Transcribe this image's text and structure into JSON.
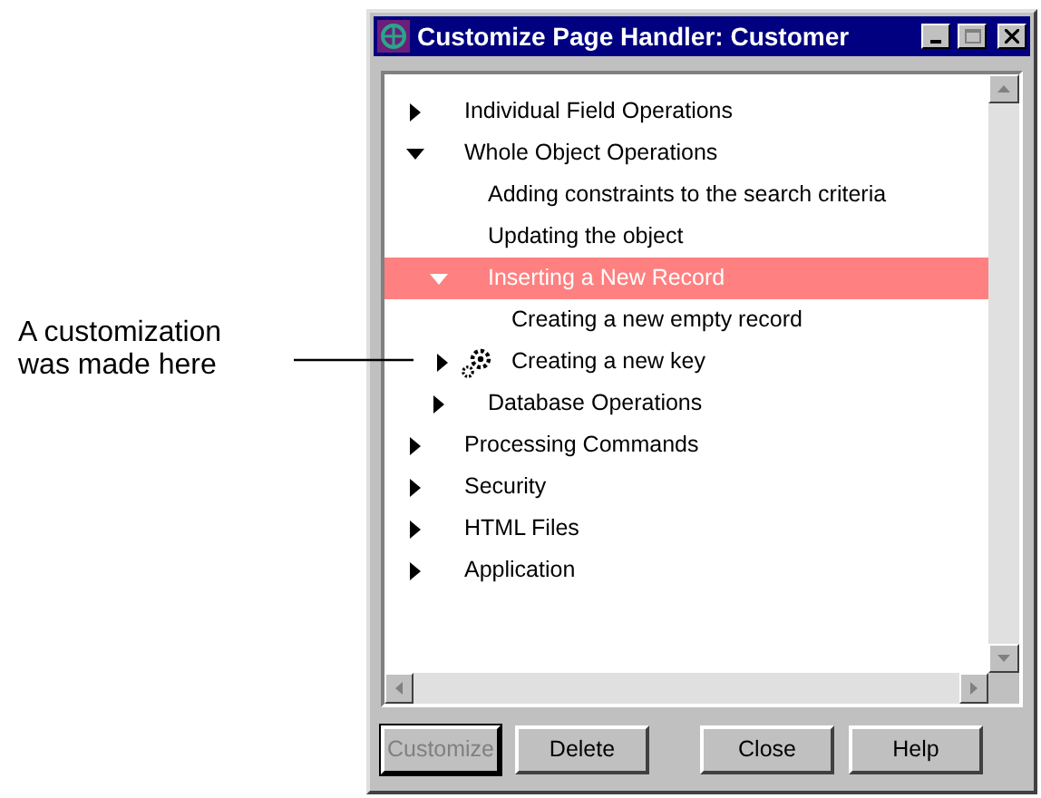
{
  "annotation": {
    "text": "A customization was made here"
  },
  "window": {
    "title": "Customize Page Handler: Customer"
  },
  "tree": [
    {
      "label": "Individual Field Operations",
      "expanded": false,
      "selected": false,
      "customized": false
    },
    {
      "label": "Whole Object Operations",
      "expanded": true,
      "selected": false,
      "customized": false,
      "children": [
        {
          "label": "Adding constraints to the search criteria",
          "selected": false,
          "customized": false
        },
        {
          "label": "Updating the object",
          "selected": false,
          "customized": false
        },
        {
          "label": "Inserting a New Record",
          "expanded": true,
          "selected": true,
          "customized": false,
          "children": [
            {
              "label": "Creating a new empty record",
              "selected": false,
              "customized": false
            },
            {
              "label": "Creating a new key",
              "expanded": false,
              "selected": false,
              "customized": true
            }
          ]
        },
        {
          "label": "Database Operations",
          "expanded": false,
          "selected": false,
          "customized": false
        }
      ]
    },
    {
      "label": "Processing Commands",
      "expanded": false,
      "selected": false,
      "customized": false
    },
    {
      "label": "Security",
      "expanded": false,
      "selected": false,
      "customized": false
    },
    {
      "label": "HTML Files",
      "expanded": false,
      "selected": false,
      "customized": false
    },
    {
      "label": "Application",
      "expanded": false,
      "selected": false,
      "customized": false
    }
  ],
  "buttons": [
    {
      "label": "Customize",
      "disabled": true
    },
    {
      "label": "Delete",
      "disabled": false
    },
    {
      "label": "Close",
      "disabled": false
    },
    {
      "label": "Help",
      "disabled": false
    }
  ]
}
